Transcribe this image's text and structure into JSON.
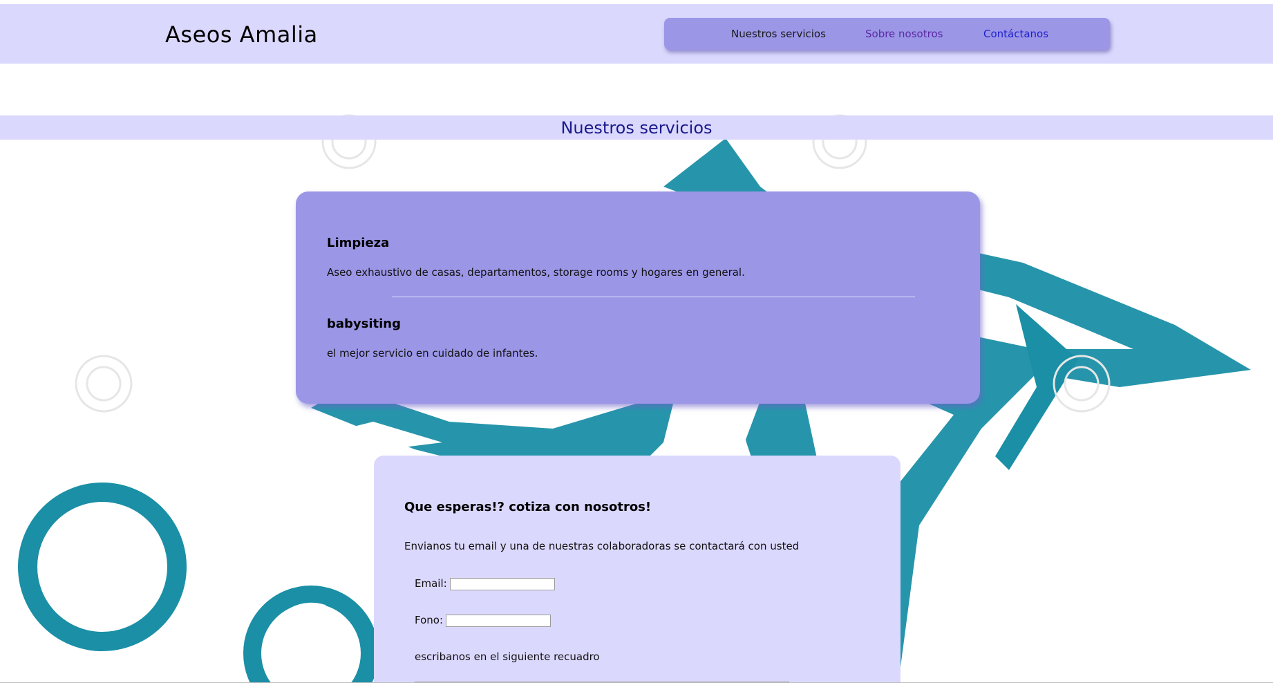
{
  "header": {
    "brand": "Aseos Amalia",
    "nav": [
      {
        "label": "Nuestros servicios"
      },
      {
        "label": "Sobre nosotros"
      },
      {
        "label": "Contáctanos"
      }
    ]
  },
  "section": {
    "title": "Nuestros servicios"
  },
  "services": [
    {
      "title": "Limpieza",
      "description": "Aseo exhaustivo de casas, departamentos, storage rooms y hogares en general."
    },
    {
      "title": "babysiting",
      "description": "el mejor servicio en cuidado de infantes."
    }
  ],
  "quote": {
    "title": "Que esperas!? cotiza con nosotros!",
    "description": "Envianos tu email y una de nuestras colaboradoras se contactará con usted",
    "email_label": "Email:",
    "email_value": "",
    "phone_label": "Fono:",
    "phone_value": "",
    "message_label": "escribanos en el siguiente recuadro"
  },
  "colors": {
    "header_bg": "#dbd8fd",
    "card_bg": "#9b96e6",
    "accent_teal": "#1a8fa6",
    "title_blue": "#1a1a8c"
  }
}
